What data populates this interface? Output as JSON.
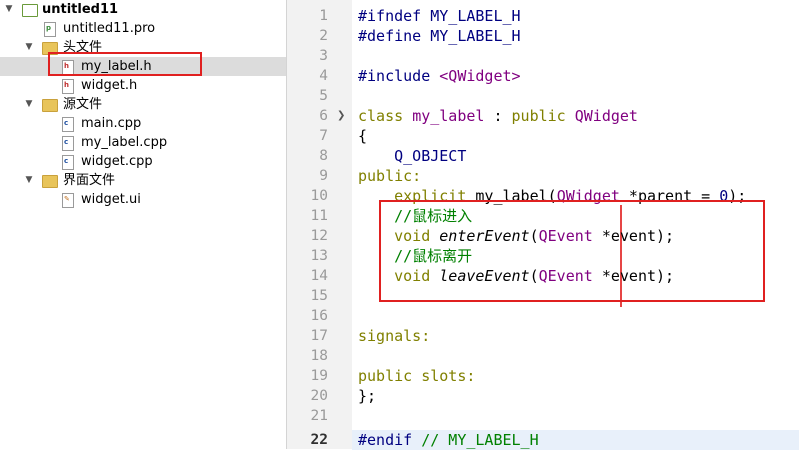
{
  "project_tree": {
    "project_name": "untitled11",
    "items": [
      {
        "label": "untitled11",
        "icon": "project-icon",
        "depth": 0,
        "expanded": true
      },
      {
        "label": "untitled11.pro",
        "icon": "pro-file-icon",
        "depth": 1
      },
      {
        "label": "头文件",
        "icon": "folder-icon",
        "depth": 1,
        "expanded": true
      },
      {
        "label": "my_label.h",
        "icon": "header-file-icon",
        "depth": 2,
        "selected": true
      },
      {
        "label": "widget.h",
        "icon": "header-file-icon",
        "depth": 2
      },
      {
        "label": "源文件",
        "icon": "source-folder-icon",
        "depth": 1,
        "expanded": true
      },
      {
        "label": "main.cpp",
        "icon": "cpp-file-icon",
        "depth": 2
      },
      {
        "label": "my_label.cpp",
        "icon": "cpp-file-icon",
        "depth": 2
      },
      {
        "label": "widget.cpp",
        "icon": "cpp-file-icon",
        "depth": 2
      },
      {
        "label": "界面文件",
        "icon": "forms-folder-icon",
        "depth": 1,
        "expanded": true
      },
      {
        "label": "widget.ui",
        "icon": "ui-file-icon",
        "depth": 2
      }
    ]
  },
  "editor": {
    "current_line": 22,
    "lines": [
      {
        "n": "1",
        "text": "#ifndef MY_LABEL_H"
      },
      {
        "n": "2",
        "text": "#define MY_LABEL_H"
      },
      {
        "n": "3",
        "text": ""
      },
      {
        "n": "4",
        "text": "#include <QWidget>"
      },
      {
        "n": "5",
        "text": ""
      },
      {
        "n": "6",
        "text": "class my_label : public QWidget"
      },
      {
        "n": "7",
        "text": "{"
      },
      {
        "n": "8",
        "text": "    Q_OBJECT"
      },
      {
        "n": "9",
        "text": "public:"
      },
      {
        "n": "10",
        "text": "    explicit my_label(QWidget *parent = 0);"
      },
      {
        "n": "11",
        "text": "    //鼠标进入"
      },
      {
        "n": "12",
        "text": "    void enterEvent(QEvent *event);"
      },
      {
        "n": "13",
        "text": "    //鼠标离开"
      },
      {
        "n": "14",
        "text": "    void leaveEvent(QEvent *event);"
      },
      {
        "n": "15",
        "text": ""
      },
      {
        "n": "16",
        "text": ""
      },
      {
        "n": "17",
        "text": "signals:"
      },
      {
        "n": "18",
        "text": ""
      },
      {
        "n": "19",
        "text": "public slots:"
      },
      {
        "n": "20",
        "text": "};"
      },
      {
        "n": "21",
        "text": ""
      },
      {
        "n": "22",
        "text": "#endif // MY_LABEL_H"
      }
    ]
  },
  "colors": {
    "keyword": "#808000",
    "preprocessor": "#000080",
    "type": "#800080",
    "comment": "#008000",
    "annotation_red": "#e02020"
  }
}
